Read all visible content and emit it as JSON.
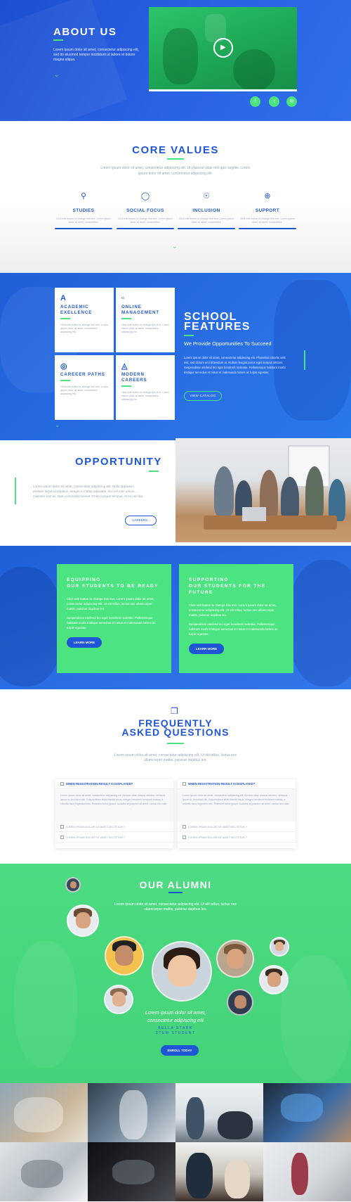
{
  "about": {
    "title": "ABOUT US",
    "text": "Lorem ipsum dolor sit amet, consectetur adipiscing elit, sed do eiusmod tempor incididunt ut labore et dolore magna aliqua.",
    "social": [
      "facebook-icon",
      "twitter-icon",
      "email-icon"
    ]
  },
  "core_values": {
    "title": "CORE VALUES",
    "subtitle": "Lorem ipsum dolor sit amet, consectetur adipiscing elit. Ut placerat vitae orci quis sagittis. Lorem ipsum dolor sit amet, consectetur adipiscing elit.",
    "items": [
      {
        "icon": "pin-icon",
        "title": "STUDIES",
        "text": "Click edit button to change this text. Lorem ipsum dolor sit amet, consectetur."
      },
      {
        "icon": "globe-icon",
        "title": "SOCIAL FOCUS",
        "text": "Click edit button to change this text. Lorem ipsum dolor sit amet, consectetur."
      },
      {
        "icon": "network-icon",
        "title": "INCLUSION",
        "text": "Click edit button to change this text. Lorem ipsum dolor sit amet, consectetur."
      },
      {
        "icon": "lifebuoy-icon",
        "title": "SUPPORT",
        "text": "Click edit button to change this text. Lorem ipsum dolor sit amet, consectetur."
      }
    ]
  },
  "features": {
    "cards": [
      {
        "icon": "letter-a-icon",
        "title": "ACADEMIC EXELLENCE",
        "text": "Click edit button to change this text. Lorem ipsum dolor sit amet, consectetur adipiscing elit."
      },
      {
        "icon": "folder-icon",
        "title": "ONLINE MANAGEMENT",
        "text": "Click edit button to change this text. Lorem ipsum dolor sit amet, consectetur adipiscing elit."
      },
      {
        "icon": "target-icon",
        "title": "CAREEER PATHS",
        "text": "Click edit button to change this text. Lorem ipsum dolor sit amet, consectetur adipiscing elit."
      },
      {
        "icon": "gamepad-icon",
        "title": "MODERN CAREERS",
        "text": "Click edit button to change this text. Lorem ipsum dolor sit amet, consectetur adipiscing elit."
      }
    ],
    "title_line1": "SCHOOL",
    "title_line2": "FEATURES",
    "subtitle": "We Provide Opportunities To Succeed",
    "text": "Lorem ipsum dolor sit amet, consectetur adipiscing elit. Phasellus lobortis velit nisl, sed dictum orci bibendum ut. Nullam feugiat purus eget tempus ultrices. Suspendisse eleifend leo eget hendrerit molestie. Pellentesque habitant morbi tristique senectus et netus et malesuada fames ac turpis egestas.",
    "button": "VIEW CATALOG"
  },
  "opportunity": {
    "title": "OPPORTUNITY",
    "text": "Lorem ipsum dolor sit amet, consectetur adipiscing elit. Nulla dignissim pretium turpis id dapibus. Integer a mattis vulputate, nisi vel ante ipsum, molestie erat ex. Nam commodo laoreet. Proin congue tempus, et ex nec dui.",
    "button": "CAREERS ›"
  },
  "equip": {
    "cards": [
      {
        "title1": "EQUIPPING",
        "title2": "OUR STUDENTS TO BE READY",
        "title3": "",
        "text": "Click edit button to change this text. Lorem ipsum dolor sit amet, consectetur adipiscing elit. Ut elit tellus, luctus nec ullamcorper mattis, pulvinar dapibus leo.",
        "text2": "Suspendisse eleifend leo eget hendrerit molestie. Pellentesque habitant morbi tristique senectus et netus et malesuada fames ac turpis egestas.",
        "button": "LEARN MORE"
      },
      {
        "title1": "SUPPORTING",
        "title2": "OUR STUDENTS FOR THE",
        "title3": "FUTURE",
        "text": "Click edit button to change this text. Lorem ipsum dolor sit amet, consectetur adipiscing elit. Ut elit tellus, luctus nec ullamcorper mattis, pulvinar dapibus leo.",
        "text2": "Suspendisse eleifend leo eget hendrerit molestie. Pellentesque habitant morbi tristique senectus et netus et malesuada fames ac turpis egestas.",
        "button": "LEARN MORE"
      }
    ]
  },
  "faq": {
    "title_line1": "FREQUENTLY",
    "title_line2": "ASKED QUESTIONS",
    "subtitle": "Lorem ipsum dolor sit amet, consectetur adipiscing elit. Ut elit tellus, luctus nec ullamcorper mattis, pulvinar dapibus leo.",
    "columns": [
      {
        "question": "WHEN REGISTRATION RESULT IS DISPLAYED?",
        "answer": "Lorem ipsum dolor sit amet, consectetur adipiscing elit. Aenean vitae massa ultricies, vehicula ipsum in, tincidunt nisi. Suspendisse vitae blandit lacus. Integer hendrerit hendrerit massa, a lobortis risus imperdiet nec. Praesent tortor ipsum, sodales at posuere sit amet, varius non odio.",
        "items": [
          "LOREM IPSUM DOLOR SIT AMET SECTETUR ?",
          "LOREM IPSUM DOLOR SIT AMET SECTETUR ?"
        ]
      },
      {
        "question": "WHEN REGISTRATION RESULT IS DISPLAYED?",
        "answer": "Lorem ipsum dolor sit amet, consectetur adipiscing elit. Aenean vitae massa ultricies, vehicula ipsum in, tincidunt nisi. Suspendisse vitae blandit lacus. Integer hendrerit hendrerit massa, a lobortis risus imperdiet nec. Praesent tortor ipsum, sodales at posuere sit amet, varius non odio.",
        "items": [
          "LOREM IPSUM DOLOR SIT AMET SECTETUR ?",
          "LOREM IPSUM DOLOR SIT AMET SECTETUR ?"
        ]
      }
    ]
  },
  "alumni": {
    "title": "OUR ALUMNI",
    "subtitle": "Lorem ipsum dolor sit amet, consectetur adipiscing elit. Ut elit tellus, luctus nec ullamcorper mattis, pulvinar dapibus leo.",
    "quote_line1": "Lorem ipsum dolor sit amet,",
    "quote_line2": "consectetur adipiscing elit",
    "name": "BELLA STARK",
    "role": "STEM STUDENT",
    "button": "ENROLL TODAY"
  },
  "colors": {
    "primary_blue": "#1f56d6",
    "accent_green": "#4be37e"
  }
}
